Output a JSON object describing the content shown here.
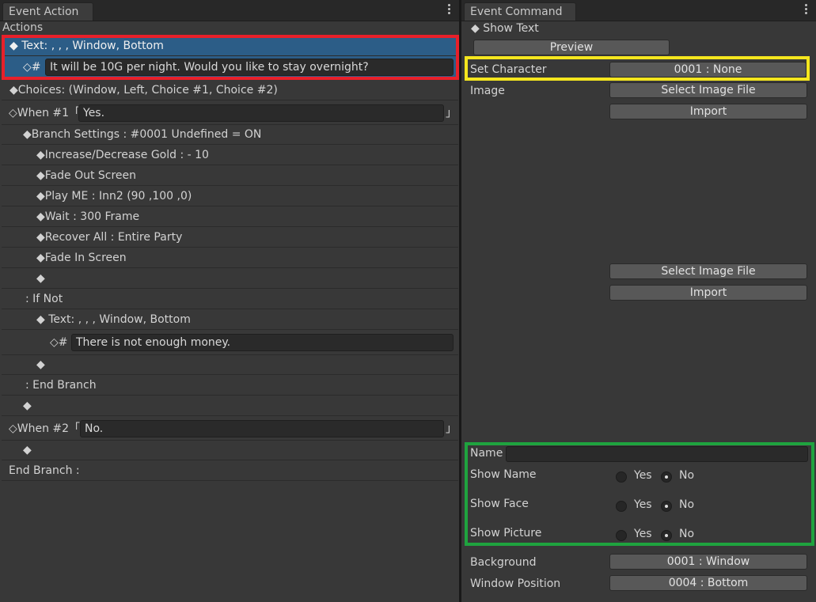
{
  "left_panel": {
    "tab": "Event Action",
    "sublabel": "Actions",
    "rows": [
      {
        "text": "◆ Text: , , , Window, Bottom"
      },
      {
        "prefix": "◇#",
        "field": "It will be 10G per night. Would you like to stay overnight?"
      },
      {
        "text": "◆Choices: (Window, Left, Choice #1, Choice #2)"
      },
      {
        "prefix": "◇When #1「",
        "field": "Yes.",
        "suffix": "」"
      },
      {
        "text": "◆Branch Settings : #0001 Undefined = ON"
      },
      {
        "text": "◆Increase/Decrease Gold : - 10"
      },
      {
        "text": "◆Fade Out Screen"
      },
      {
        "text": "◆Play ME : Inn2 (90 ,100 ,0)"
      },
      {
        "text": "◆Wait : 300 Frame"
      },
      {
        "text": "◆Recover All : Entire Party"
      },
      {
        "text": "◆Fade In Screen"
      },
      {
        "text": "◆"
      },
      {
        "text": ": If Not"
      },
      {
        "text": "◆ Text: , , , Window, Bottom"
      },
      {
        "prefix": "◇#",
        "field": "There is not enough money."
      },
      {
        "text": "◆"
      },
      {
        "text": ": End Branch"
      },
      {
        "text": "◆"
      },
      {
        "prefix": "◇When #2「",
        "field": "No.",
        "suffix": "」"
      },
      {
        "text": "◆"
      },
      {
        "text": "End Branch :"
      }
    ]
  },
  "right_panel": {
    "tab": "Event Command",
    "title": "◆ Show Text",
    "preview_button": "Preview",
    "set_character_label": "Set Character",
    "set_character_value": "0001 : None",
    "image_label": "Image",
    "select_image_1": "Select Image File",
    "import_1": "Import",
    "select_image_2": "Select Image File",
    "import_2": "Import",
    "name_label": "Name",
    "name_value": "",
    "show_name_label": "Show Name",
    "show_face_label": "Show Face",
    "show_picture_label": "Show Picture",
    "yes": "Yes",
    "no": "No",
    "background_label": "Background",
    "background_value": "0001 : Window",
    "window_position_label": "Window Position",
    "window_position_value": "0004 : Bottom"
  },
  "highlights": {
    "red": "#e8202a",
    "yellow": "#f5e61e",
    "green": "#1fa33f"
  }
}
